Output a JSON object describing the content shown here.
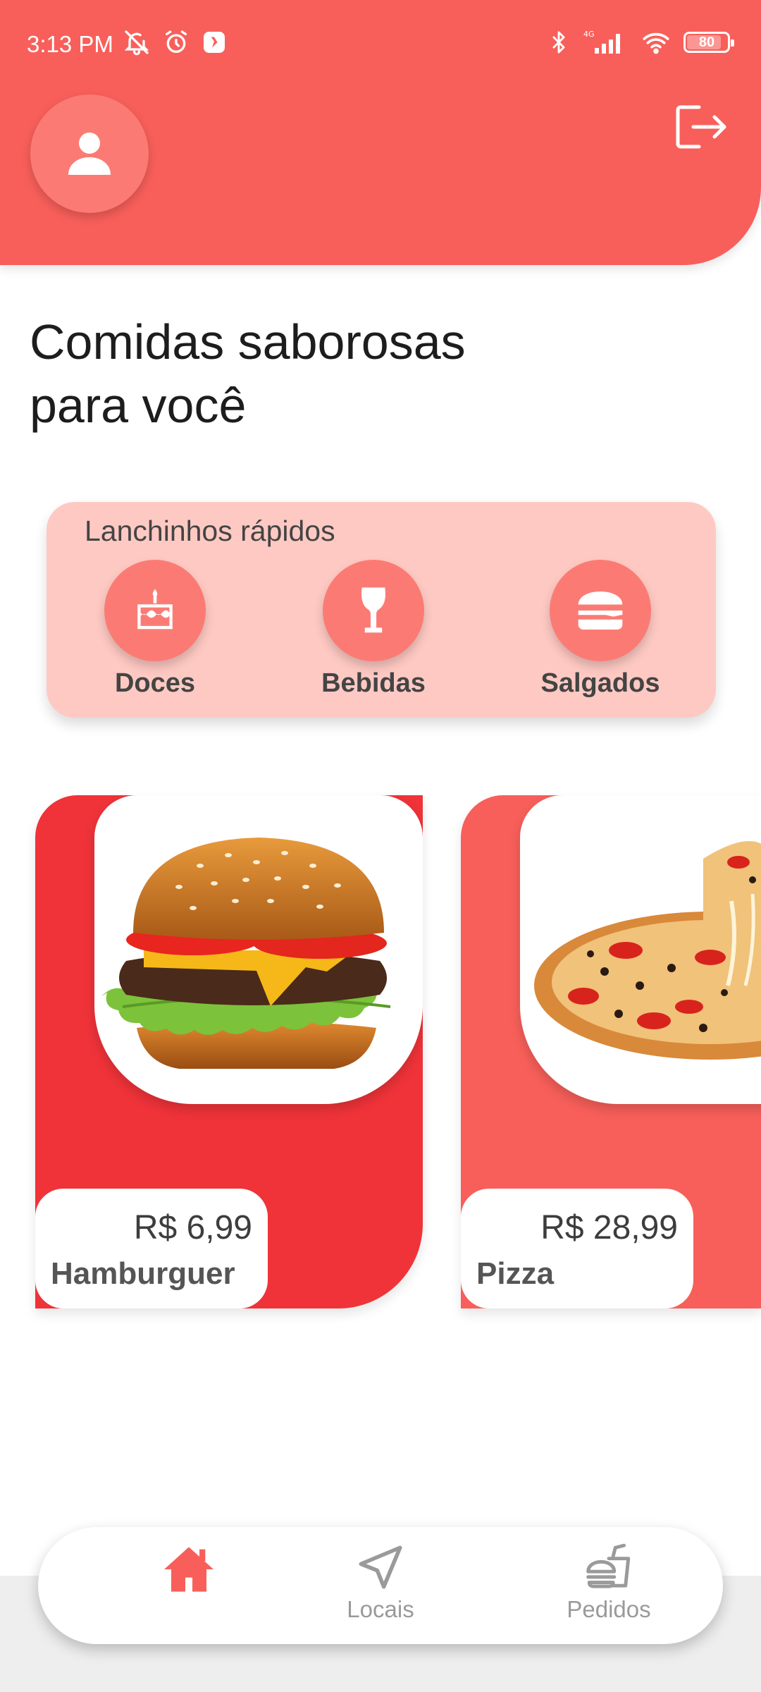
{
  "colors": {
    "primary": "#f85f5a",
    "accent_circle": "#fb7b74",
    "category_panel": "#ffc9c3",
    "card_red": "#ef3339",
    "card_coral": "#f85f5a",
    "nav_active": "#f85f5a",
    "nav_inactive": "#9a9a9a"
  },
  "status_bar": {
    "time": "3:13 PM",
    "battery": "80",
    "left_icons": [
      "bell-off-icon",
      "alarm-icon",
      "app-notification-icon"
    ],
    "right_icons": [
      "bluetooth-icon",
      "cellular-4g-icon",
      "wifi-icon",
      "battery-icon"
    ]
  },
  "header": {
    "avatar_icon": "user-icon",
    "logout_icon": "logout-icon"
  },
  "page": {
    "title_line1": "Comidas saborosas",
    "title_line2": "para você"
  },
  "categories": {
    "heading": "Lanchinhos rápidos",
    "items": [
      {
        "label": "Doces",
        "icon": "cake-icon"
      },
      {
        "label": "Bebidas",
        "icon": "wine-glass-icon"
      },
      {
        "label": "Salgados",
        "icon": "burger-icon"
      }
    ]
  },
  "products": [
    {
      "name": "Hamburguer",
      "price": "R$ 6,99",
      "image": "hamburger-image"
    },
    {
      "name": "Pizza",
      "price": "R$ 28,99",
      "image": "pizza-image"
    }
  ],
  "bottom_nav": {
    "items": [
      {
        "label": "",
        "icon": "home-icon",
        "active": true
      },
      {
        "label": "Locais",
        "icon": "navigation-arrow-icon",
        "active": false
      },
      {
        "label": "Pedidos",
        "icon": "food-order-icon",
        "active": false
      }
    ]
  }
}
